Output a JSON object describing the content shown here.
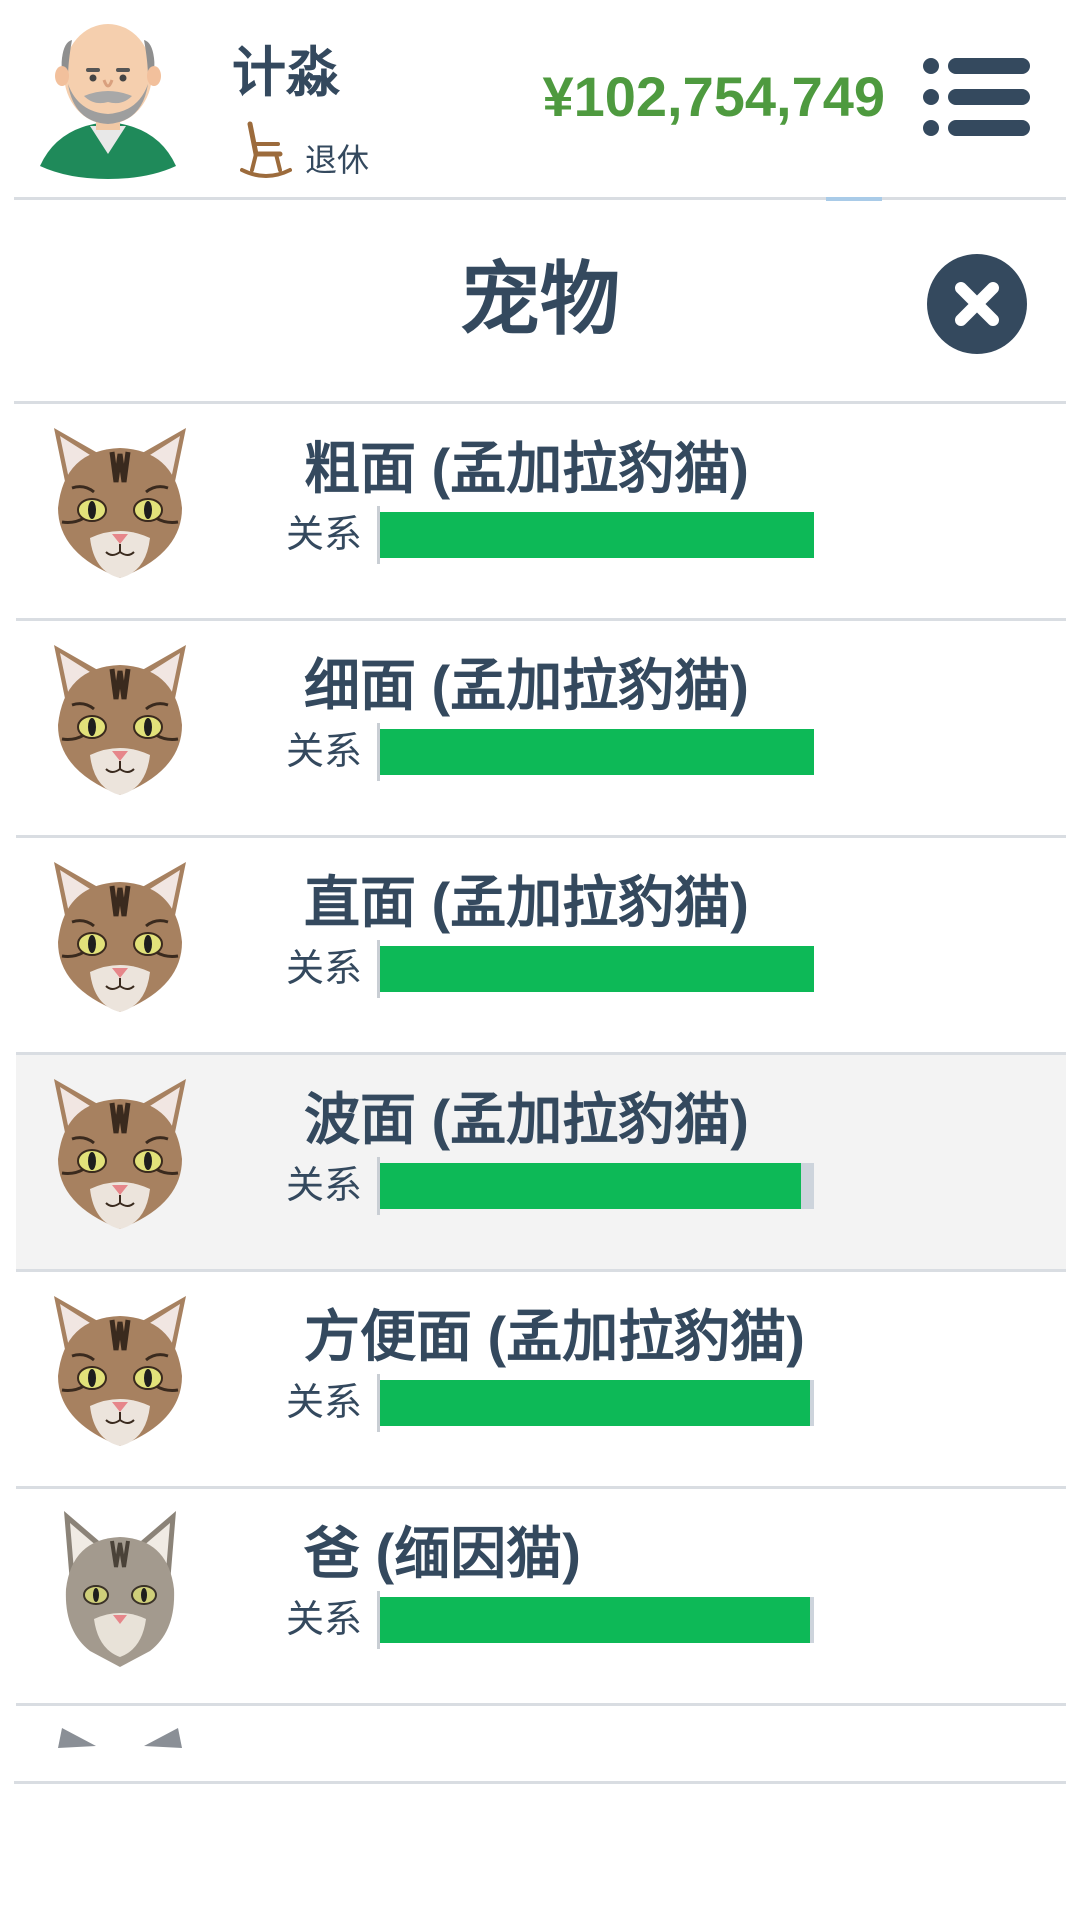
{
  "header": {
    "player_name": "计淼",
    "status_icon": "rocking-chair-icon",
    "status": "退休",
    "money": "¥102,754,749",
    "money_color": "#4e9a3f",
    "menu_icon": "list-menu-icon"
  },
  "page": {
    "title": "宠物",
    "close_icon": "close-icon"
  },
  "relationship_label": "关系",
  "colors": {
    "text": "#34495e",
    "bar_fill": "#0db957",
    "bar_track": "#cdd4dc",
    "selected_row": "#f3f3f3"
  },
  "pets": [
    {
      "name": "粗面 (孟加拉豹猫)",
      "relationship_label": "关系",
      "relationship": 1.0,
      "icon": "bengal-cat-icon"
    },
    {
      "name": "细面 (孟加拉豹猫)",
      "relationship_label": "关系",
      "relationship": 1.0,
      "icon": "bengal-cat-icon"
    },
    {
      "name": "直面 (孟加拉豹猫)",
      "relationship_label": "关系",
      "relationship": 1.0,
      "icon": "bengal-cat-icon"
    },
    {
      "name": "波面 (孟加拉豹猫)",
      "relationship_label": "关系",
      "relationship": 0.97,
      "icon": "bengal-cat-icon",
      "selected": true
    },
    {
      "name": "方便面 (孟加拉豹猫)",
      "relationship_label": "关系",
      "relationship": 0.99,
      "icon": "bengal-cat-icon"
    },
    {
      "name": "爸 (缅因猫)",
      "relationship_label": "关系",
      "relationship": 0.99,
      "icon": "maine-coon-cat-icon"
    }
  ]
}
